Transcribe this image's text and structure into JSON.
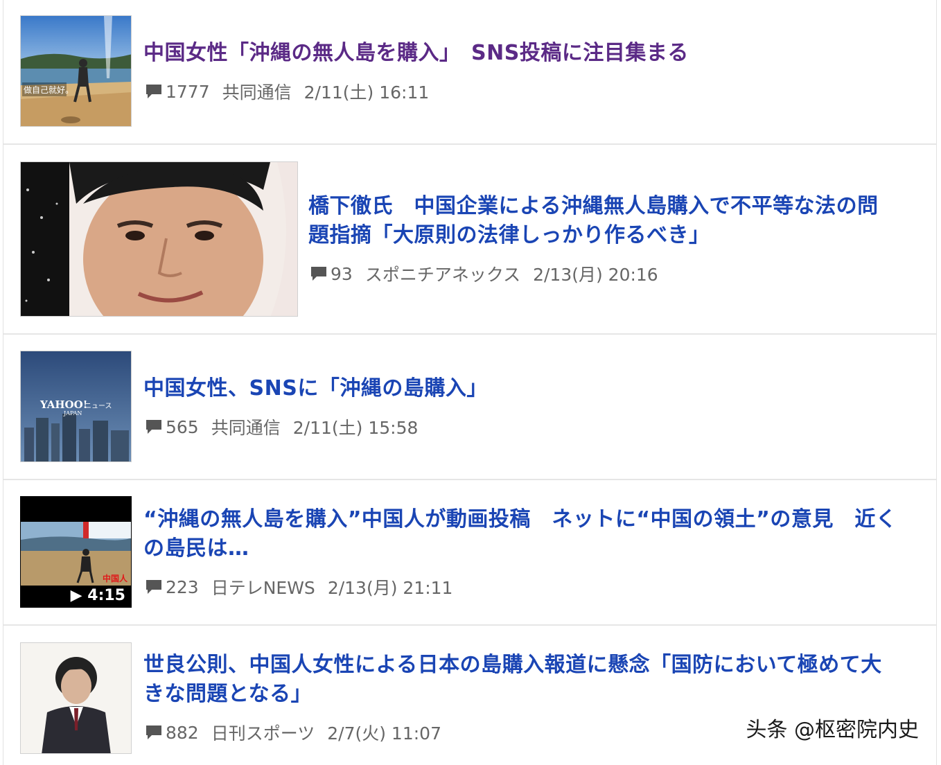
{
  "colors": {
    "visited": "#5b2a86",
    "link": "#1a45b4",
    "meta": "#666666"
  },
  "icons": {
    "comment": "comment-icon",
    "play": "play-icon"
  },
  "articles": [
    {
      "title": "中国女性「沖縄の無人島を購入」　SNS投稿に注目集まる",
      "comments": "1777",
      "source": "共同通信",
      "date": "2/11(土) 16:11",
      "thumb_caption": "做自己就好。"
    },
    {
      "title_lines": [
        "橋下徹氏　中国企業による沖縄無人島購入で不平等な法の問",
        "題指摘「大原則の法律しっかり作るべき」"
      ],
      "comments": "93",
      "source": "スポニチアネックス",
      "date": "2/13(月) 20:16"
    },
    {
      "title": "中国女性、SNSに「沖縄の島購入」",
      "comments": "565",
      "source": "共同通信",
      "date": "2/11(土) 15:58",
      "thumb_logo": "YAHOO!",
      "thumb_logo_sub": "JAPAN",
      "thumb_logo_news": "ニュース"
    },
    {
      "title_lines": [
        "“沖縄の無人島を購入”中国人が動画投稿　ネットに“中国の領土”の意見　近く",
        "の島民は…"
      ],
      "comments": "223",
      "source": "日テレNEWS",
      "date": "2/13(月) 21:11",
      "duration": "4:15",
      "thumb_overlay": "中国人"
    },
    {
      "title_lines": [
        "世良公則、中国人女性による日本の島購入報道に懸念「国防において極めて大",
        "きな問題となる」"
      ],
      "comments": "882",
      "source": "日刊スポーツ",
      "date": "2/7(火) 11:07"
    }
  ],
  "watermark": "头条 @枢密院内史"
}
